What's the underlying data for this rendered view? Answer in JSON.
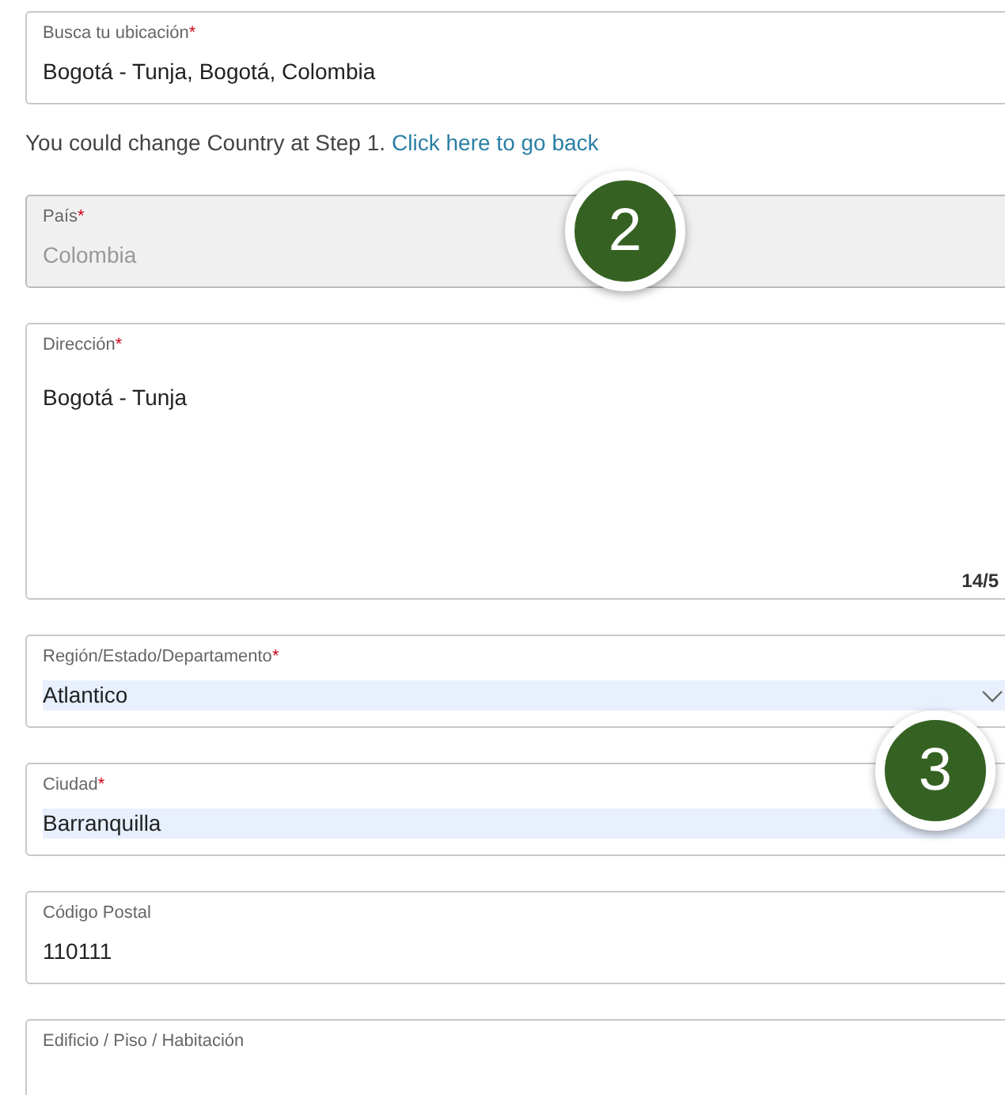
{
  "fields": [
    {
      "kind": "text",
      "label": "Busca tu ubicación",
      "required_mark": "*",
      "value": "Bogotá - Tunja, Bogotá, Colombia",
      "disabled": false,
      "autofilled": false
    },
    {
      "kind": "note",
      "text": "You could change Country at Step 1.",
      "link": "Click here to go back"
    },
    {
      "kind": "text",
      "label": "País",
      "required_mark": "*",
      "value": "Colombia",
      "disabled": true,
      "autofilled": false
    },
    {
      "kind": "textarea",
      "label": "Dirección",
      "required_mark": "*",
      "value": "Bogotá - Tunja",
      "counter": "14/5",
      "disabled": false,
      "autofilled": false
    },
    {
      "kind": "select",
      "label": "Región/Estado/Departamento",
      "required_mark": "*",
      "value": "Atlantico",
      "disabled": false,
      "autofilled": true
    },
    {
      "kind": "select",
      "label": "Ciudad",
      "required_mark": "*",
      "value": "Barranquilla",
      "disabled": false,
      "autofilled": true
    },
    {
      "kind": "text",
      "label": "Código Postal",
      "value": "110111",
      "disabled": false,
      "autofilled": false
    },
    {
      "kind": "textarea",
      "label": "Edificio / Piso / Habitación",
      "disabled": false
    }
  ],
  "callouts": [
    {
      "number": "2"
    },
    {
      "number": "3"
    }
  ]
}
